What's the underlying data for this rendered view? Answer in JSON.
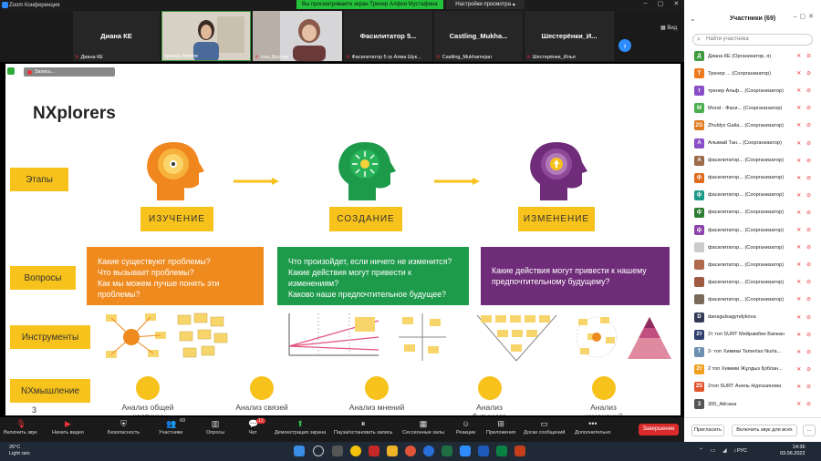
{
  "window": {
    "title": "Zoom Конференция"
  },
  "share_banner": "Вы просматриваете экран Тренер Алфия Мустафина",
  "view_options": "Настройки просмотра",
  "view_button": "Вид",
  "video_tiles": [
    {
      "name": "Диана КЕ",
      "label": "Диана КЕ",
      "muted": true
    },
    {
      "name": "",
      "label": "тренер Алфия",
      "muted": false
    },
    {
      "name": "",
      "label": "сош Достык",
      "muted": true
    },
    {
      "name": "Фасилитатор 5...",
      "label": "Фасилитатор 5 гр Алма Шук...",
      "muted": true
    },
    {
      "name": "Castling_Mukha...",
      "label": "Castling_Mukhamejan",
      "muted": true
    },
    {
      "name": "Шестерёнки_И...",
      "label": "Шестерёнки_Илья",
      "muted": true
    }
  ],
  "recording": {
    "label": "Запись..."
  },
  "slide": {
    "title": "NXplorers",
    "row_labels": [
      "Этапы",
      "Вопросы",
      "Инструменты",
      "NXмышление"
    ],
    "stages": [
      "ИЗУЧЕНИЕ",
      "СОЗДАНИЕ",
      "ИЗМЕНЕНИЕ"
    ],
    "questions": [
      {
        "text": "Какие существуют проблемы?\nЧто вызывает проблемы?\nКак мы можем лучше понять эти проблемы?",
        "color": "#ef8a1e"
      },
      {
        "text": "Что произойдет, если ничего не изменится?\nКакие действия могут привести к изменениям?\nКаково наше предпочтительное будущее?",
        "color": "#1e9a4b"
      },
      {
        "text": "Какие действия могут привести к нашему предпочтительному будущему?",
        "color": "#6f2c78"
      }
    ],
    "nx_thinking": [
      "Анализ общей картины",
      "Анализ связей",
      "Анализ мнений",
      "Анализ будущего",
      "Анализ изменений"
    ],
    "page_number": "3"
  },
  "toolbar": {
    "items": [
      "Включить звук",
      "Начать видео",
      "Безопасность",
      "Участники",
      "Опросы",
      "Чат",
      "Демонстрация экрана",
      "Пауза/остановить запись",
      "Сессионные залы",
      "Реакции",
      "Приложения",
      "Доски сообщений",
      "Дополнительно"
    ],
    "participants_count": "69",
    "chat_count": "11",
    "end_label": "Завершение"
  },
  "panel": {
    "title": "Участники (69)",
    "search_placeholder": "Найти участника",
    "participants": [
      {
        "name": "Диана КЕ (Организатор, я)",
        "initial": "Д",
        "color": "#3c9a3c"
      },
      {
        "name": "Тренер ... (Соорганизатор)",
        "initial": "Т",
        "color": "#f07b1e"
      },
      {
        "name": "тренер Альф... (Соорганизатор)",
        "initial": "т",
        "color": "#8a4fc7"
      },
      {
        "name": "Murat - Фаси... (Соорганизатор)",
        "initial": "M",
        "color": "#4caf50"
      },
      {
        "name": "Zhuldyz Galia... (Соорганизатор)",
        "initial": "ZG",
        "color": "#e07a1e"
      },
      {
        "name": "Алымай Тан... (Соорганизатор)",
        "initial": "А",
        "color": "#8a4fc7"
      },
      {
        "name": "фасилитатор... (Соорганизатор)",
        "initial": "A",
        "color": "#9c6b4a"
      },
      {
        "name": "фасилитатор... (Соорганизатор)",
        "initial": "ф",
        "color": "#e06a1e"
      },
      {
        "name": "фасилитатор... (Соорганизатор)",
        "initial": "ф",
        "color": "#1e9a8b"
      },
      {
        "name": "фасилитатор... (Соорганизатор)",
        "initial": "ф",
        "color": "#2e7d32"
      },
      {
        "name": "фасилитатор... (Соорганизатор)",
        "initial": "ф",
        "color": "#8e44ad"
      },
      {
        "name": "фасилитатор... (Соорганизатор)",
        "initial": "",
        "color": "#cccccc"
      },
      {
        "name": "фасилитатор... (Соорганизатор)",
        "initial": "",
        "color": "#b06a50"
      },
      {
        "name": "фасилитатор... (Соорганизатор)",
        "initial": "",
        "color": "#a05a40"
      },
      {
        "name": "фасилитатор... (Соорганизатор)",
        "initial": "",
        "color": "#7a6a5a"
      },
      {
        "name": "danagulsagyndykova",
        "initial": "D",
        "color": "#333a55"
      },
      {
        "name": "2т топ SURT Мейрамбек Бағжан",
        "initial": "2т",
        "color": "#2f3f6f"
      },
      {
        "name": "2- топ Химики Tamerlan Nurla...",
        "initial": "Т",
        "color": "#6a8fb0"
      },
      {
        "name": "2 топ Химики Жұлдыз Қоблан...",
        "initial": "2т",
        "color": "#f0a020"
      },
      {
        "name": "2топ SURT Анель Нургазинова",
        "initial": "2S",
        "color": "#e0552e"
      },
      {
        "name": "300_Айсана",
        "initial": "3",
        "color": "#555555"
      }
    ],
    "invite_label": "Пригласить",
    "unmute_all_label": "Включить звук для всех"
  },
  "taskbar": {
    "temp": "26°C",
    "weather": "Light rain",
    "lang": "РУС",
    "time": "14:36",
    "date": "03.06.2022"
  }
}
